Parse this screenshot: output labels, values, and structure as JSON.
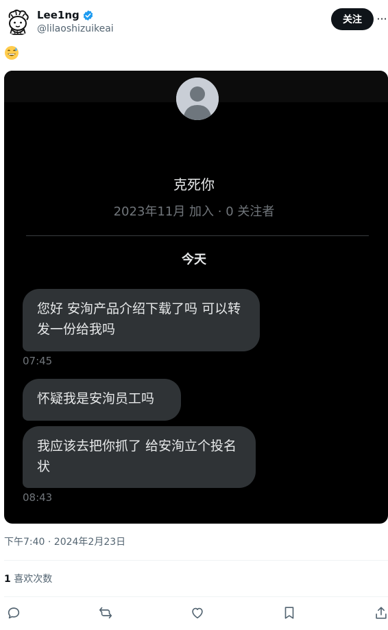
{
  "author": {
    "display_name": "Lee1ng",
    "handle": "@lilaoshizuikeai",
    "verified": true,
    "avatar_icon": "doodle-avatar-icon"
  },
  "header": {
    "follow_label": "关注",
    "more_label": "···"
  },
  "post": {
    "emoji_icon": "grinning-sweat-emoji-icon"
  },
  "screenshot": {
    "contact_name": "克死你",
    "contact_meta": "2023年11月 加入 · 0 关注者",
    "date_separator": "今天",
    "messages": [
      {
        "text": "您好 安洵产品介绍下载了吗 可以转发一份给我吗"
      },
      {
        "text": "怀疑我是安洵员工吗"
      },
      {
        "text": "我应该去把你抓了 给安洵立个投名状"
      }
    ],
    "times": [
      "07:45",
      "08:43"
    ]
  },
  "meta": {
    "timestamp": "下午7:40 · 2024年2月23日",
    "likes_count": "1",
    "likes_label": "喜欢次数"
  },
  "actions": [
    {
      "icon": "reply-icon"
    },
    {
      "icon": "repost-icon"
    },
    {
      "icon": "like-icon"
    },
    {
      "icon": "bookmark-icon"
    },
    {
      "icon": "share-icon"
    }
  ],
  "colors": {
    "accent": "#1d9bf0",
    "text": "#0f1419",
    "muted": "#536471",
    "bubble": "#2f3336"
  }
}
